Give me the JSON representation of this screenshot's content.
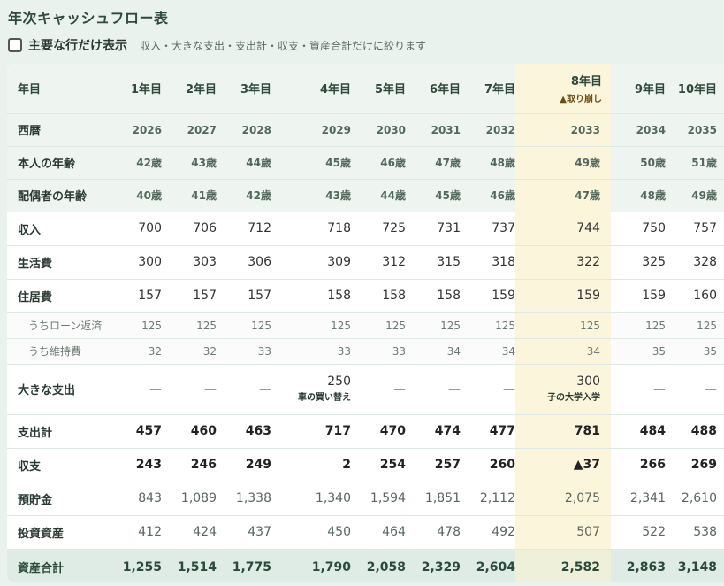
{
  "title": "年次キャッシュフロー表",
  "toggle": {
    "label": "主要な行だけ表示",
    "description": "収入・大きな支出・支出計・収支・資産合計だけに絞ります",
    "checked": false
  },
  "columns": [
    {
      "label": "1年目"
    },
    {
      "label": "2年目"
    },
    {
      "label": "3年目"
    },
    {
      "label": "4年目"
    },
    {
      "label": "5年目"
    },
    {
      "label": "6年目"
    },
    {
      "label": "7年目"
    },
    {
      "label": "8年目",
      "badge": "▲取り崩し"
    },
    {
      "label": "9年目"
    },
    {
      "label": "10年目"
    }
  ],
  "header_label": "年目",
  "highlight_color": "#fbf5dc",
  "rows": {
    "year": {
      "label": "西暦",
      "values": [
        "2026",
        "2027",
        "2028",
        "2029",
        "2030",
        "2031",
        "2032",
        "2033",
        "2034",
        "2035"
      ]
    },
    "age_self": {
      "label": "本人の年齢",
      "values": [
        "42歳",
        "43歳",
        "44歳",
        "45歳",
        "46歳",
        "47歳",
        "48歳",
        "49歳",
        "50歳",
        "51歳"
      ]
    },
    "age_spouse": {
      "label": "配偶者の年齢",
      "values": [
        "40歳",
        "41歳",
        "42歳",
        "43歳",
        "44歳",
        "45歳",
        "46歳",
        "47歳",
        "48歳",
        "49歳"
      ]
    },
    "income": {
      "label": "収入",
      "values": [
        "700",
        "706",
        "712",
        "718",
        "725",
        "731",
        "737",
        "744",
        "750",
        "757"
      ]
    },
    "living": {
      "label": "生活費",
      "values": [
        "300",
        "303",
        "306",
        "309",
        "312",
        "315",
        "318",
        "322",
        "325",
        "328"
      ]
    },
    "housing": {
      "label": "住居費",
      "values": [
        "157",
        "157",
        "157",
        "158",
        "158",
        "158",
        "159",
        "159",
        "159",
        "160"
      ]
    },
    "loan": {
      "label": "うちローン返済",
      "values": [
        "125",
        "125",
        "125",
        "125",
        "125",
        "125",
        "125",
        "125",
        "125",
        "125"
      ]
    },
    "maintenance": {
      "label": "うち維持費",
      "values": [
        "32",
        "32",
        "33",
        "33",
        "33",
        "34",
        "34",
        "34",
        "35",
        "35"
      ]
    },
    "big_expense": {
      "label": "大きな支出",
      "values": [
        "—",
        "—",
        "—",
        "250",
        "—",
        "—",
        "—",
        "300",
        "—",
        "—"
      ],
      "notes": [
        "",
        "",
        "",
        "車の買い替え",
        "",
        "",
        "",
        "子の大学入学",
        "",
        ""
      ]
    },
    "expense_total": {
      "label": "支出計",
      "values": [
        "457",
        "460",
        "463",
        "717",
        "470",
        "474",
        "477",
        "781",
        "484",
        "488"
      ]
    },
    "balance": {
      "label": "収支",
      "values": [
        "243",
        "246",
        "249",
        "2",
        "254",
        "257",
        "260",
        "▲37",
        "266",
        "269"
      ]
    },
    "savings": {
      "label": "預貯金",
      "values": [
        "843",
        "1,089",
        "1,338",
        "1,340",
        "1,594",
        "1,851",
        "2,112",
        "2,075",
        "2,341",
        "2,610"
      ]
    },
    "investment": {
      "label": "投資資産",
      "values": [
        "412",
        "424",
        "437",
        "450",
        "464",
        "478",
        "492",
        "507",
        "522",
        "538"
      ]
    },
    "asset_total": {
      "label": "資産合計",
      "values": [
        "1,255",
        "1,514",
        "1,775",
        "1,790",
        "2,058",
        "2,329",
        "2,604",
        "2,582",
        "2,863",
        "3,148"
      ]
    }
  }
}
